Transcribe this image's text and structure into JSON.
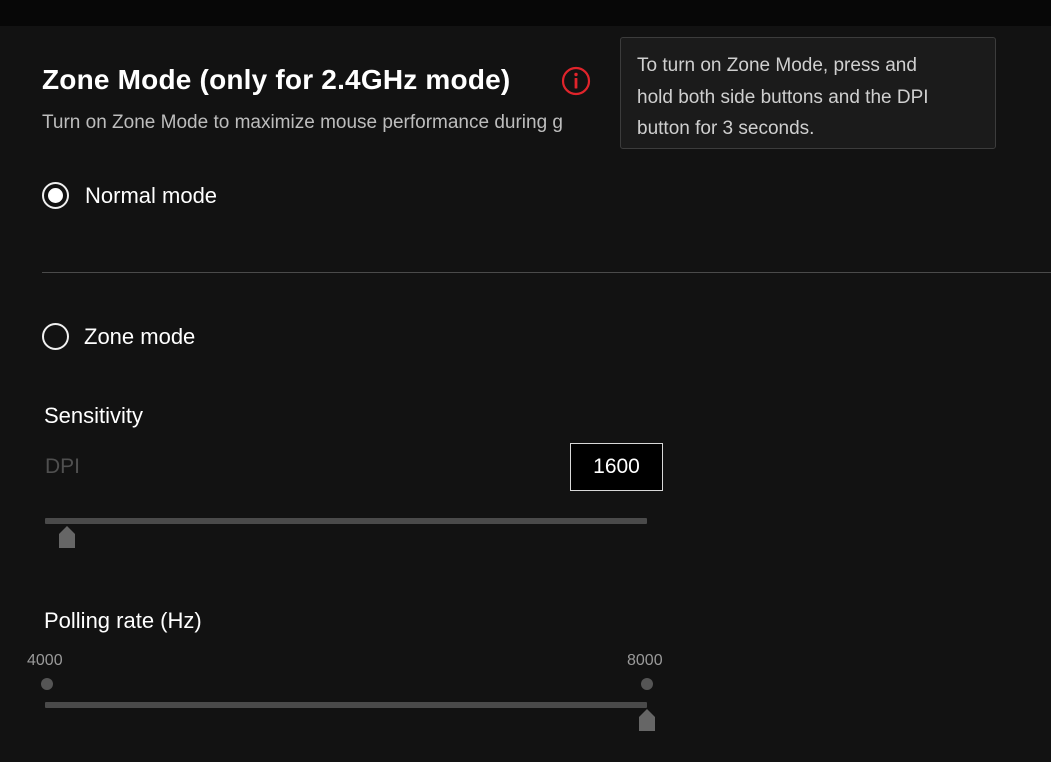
{
  "zone_mode": {
    "title": "Zone Mode (only for 2.4GHz mode)",
    "subtitle": "Turn on Zone Mode to maximize mouse performance during g",
    "info_icon": "info-circle-icon",
    "tooltip_lines": [
      "To turn on Zone Mode, press and",
      "hold both side buttons and the DPI",
      "button for 3 seconds."
    ],
    "accent_color": "#e0242b"
  },
  "modes": {
    "normal_label": "Normal mode",
    "normal_selected": true,
    "zone_label": "Zone mode",
    "zone_selected": false
  },
  "sensitivity": {
    "label": "Sensitivity",
    "dpi_label": "DPI",
    "dpi_value": "1600",
    "slider_fraction": 0.037
  },
  "polling": {
    "label": "Polling rate (Hz)",
    "min_label": "4000",
    "max_label": "8000",
    "value": 8000
  }
}
